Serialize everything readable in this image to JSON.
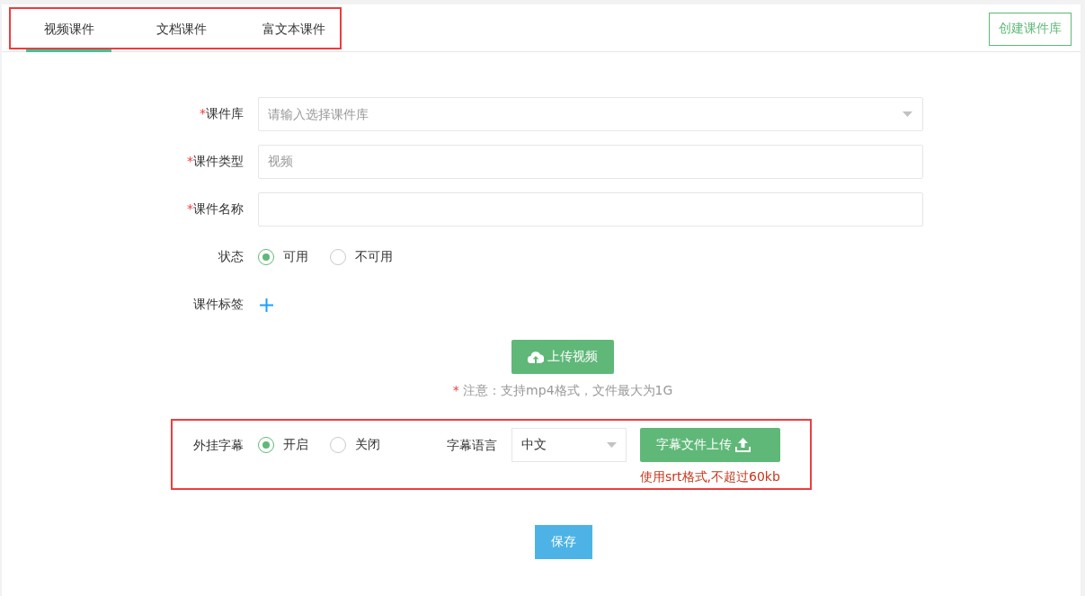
{
  "tabs": [
    {
      "label": "视频课件",
      "selected": true
    },
    {
      "label": "文档课件",
      "selected": false
    },
    {
      "label": "富文本课件",
      "selected": false
    }
  ],
  "create_library_button": "创建课件库",
  "fields": [
    {
      "kind": "select",
      "label": "课件库",
      "required_mark": "*",
      "placeholder": "请输入选择课件库"
    },
    {
      "kind": "text",
      "label": "课件类型",
      "required_mark": "*",
      "value": "视频",
      "disabled": true
    },
    {
      "kind": "text",
      "label": "课件名称",
      "required_mark": "*"
    },
    {
      "kind": "radio",
      "label": "状态",
      "options": [
        {
          "label": "可用",
          "selected": true
        },
        {
          "label": "不可用",
          "selected": false
        }
      ]
    },
    {
      "kind": "tags",
      "label": "课件标签"
    }
  ],
  "upload": {
    "button": "上传视频",
    "note_mark": "*",
    "note": "注意：支持mp4格式，文件最大为1G"
  },
  "subtitles": {
    "label": "外挂字幕",
    "options": [
      {
        "label": "开启",
        "selected": true
      },
      {
        "label": "关闭",
        "selected": false
      }
    ],
    "language_label": "字幕语言",
    "language": "中文",
    "upload_button": "字幕文件上传",
    "hint": "使用srt格式,不超过60kb"
  },
  "save_button": "保存"
}
